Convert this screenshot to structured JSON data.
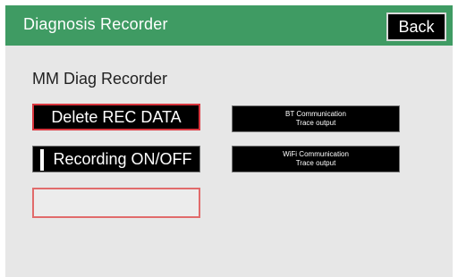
{
  "header": {
    "title": "Diagnosis Recorder",
    "back_label": "Back"
  },
  "section": {
    "title": "MM Diag Recorder"
  },
  "buttons": {
    "delete_label": "Delete REC DATA",
    "recording_label": "Recording ON/OFF",
    "bt_line1": "BT Communication",
    "bt_line2": "Trace output",
    "wifi_line1": "WiFi Communication",
    "wifi_line2": "Trace output"
  },
  "colors": {
    "header_green": "#3f9b63",
    "highlight_red": "#d9363e"
  }
}
